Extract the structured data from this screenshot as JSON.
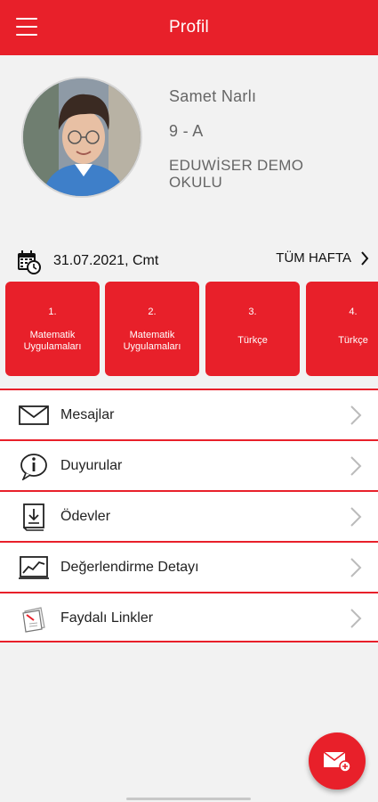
{
  "header": {
    "title": "Profil",
    "menu_icon": "hamburger-menu-icon"
  },
  "profile": {
    "name": "Samet Narlı",
    "class": "9 - A",
    "school": "EDUWİSER DEMO OKULU"
  },
  "schedule": {
    "date": "31.07.2021, Cmt",
    "week_link": "TÜM HAFTA",
    "lessons": [
      {
        "num": "1.",
        "name": "Matematik Uygulamaları"
      },
      {
        "num": "2.",
        "name": "Matematik Uygulamaları"
      },
      {
        "num": "3.",
        "name": "Türkçe"
      },
      {
        "num": "4.",
        "name": "Türkçe"
      }
    ]
  },
  "menu": {
    "items": [
      {
        "label": "Mesajlar",
        "icon": "envelope-icon"
      },
      {
        "label": "Duyurular",
        "icon": "info-bubble-icon"
      },
      {
        "label": "Ödevler",
        "icon": "homework-book-icon"
      },
      {
        "label": "Değerlendirme Detayı",
        "icon": "chart-icon"
      },
      {
        "label": "Faydalı Linkler",
        "icon": "links-icon"
      }
    ]
  },
  "colors": {
    "accent": "#e8202a",
    "background": "#f2f2f2"
  }
}
